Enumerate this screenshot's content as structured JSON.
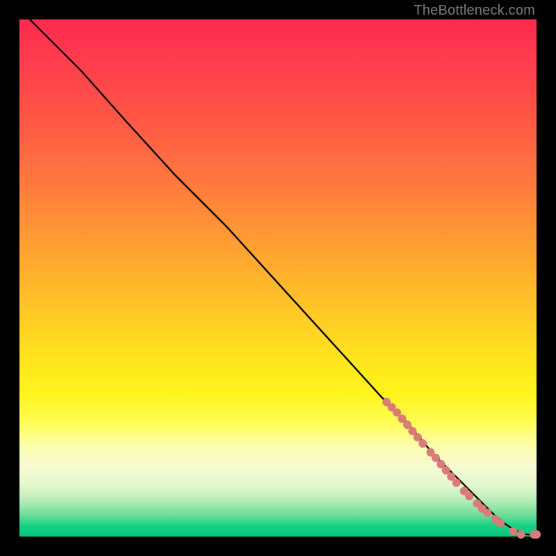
{
  "credit": "TheBottleneck.com",
  "chart_data": {
    "type": "line",
    "title": "",
    "xlabel": "",
    "ylabel": "",
    "xlim": [
      0,
      100
    ],
    "ylim": [
      0,
      100
    ],
    "series": [
      {
        "name": "curve",
        "x": [
          0,
          3,
          7,
          12,
          20,
          30,
          40,
          50,
          60,
          70,
          75,
          80,
          84,
          87,
          90,
          92,
          94,
          95.5,
          97,
          98,
          100
        ],
        "y": [
          102,
          99,
          95,
          90,
          81,
          70,
          60,
          49,
          38,
          27,
          22,
          16,
          12,
          9,
          6,
          4,
          2.4,
          1.4,
          0.7,
          0.4,
          0.4
        ]
      }
    ],
    "markers": [
      {
        "x": 71.0,
        "y": 26.0,
        "r": 6
      },
      {
        "x": 72.0,
        "y": 25.0,
        "r": 6
      },
      {
        "x": 73.0,
        "y": 24.0,
        "r": 6
      },
      {
        "x": 74.0,
        "y": 22.8,
        "r": 6
      },
      {
        "x": 75.0,
        "y": 21.6,
        "r": 6
      },
      {
        "x": 76.0,
        "y": 20.4,
        "r": 6
      },
      {
        "x": 77.0,
        "y": 19.2,
        "r": 6
      },
      {
        "x": 78.0,
        "y": 18.0,
        "r": 6
      },
      {
        "x": 79.5,
        "y": 16.3,
        "r": 6
      },
      {
        "x": 80.5,
        "y": 15.2,
        "r": 6
      },
      {
        "x": 81.5,
        "y": 14.0,
        "r": 6
      },
      {
        "x": 82.5,
        "y": 12.8,
        "r": 6
      },
      {
        "x": 83.5,
        "y": 11.6,
        "r": 6
      },
      {
        "x": 84.5,
        "y": 10.4,
        "r": 6
      },
      {
        "x": 86.0,
        "y": 8.8,
        "r": 6
      },
      {
        "x": 87.0,
        "y": 7.8,
        "r": 6
      },
      {
        "x": 88.5,
        "y": 6.4,
        "r": 6
      },
      {
        "x": 89.5,
        "y": 5.4,
        "r": 6
      },
      {
        "x": 90.5,
        "y": 4.6,
        "r": 6
      },
      {
        "x": 92.0,
        "y": 3.4,
        "r": 6
      },
      {
        "x": 93.0,
        "y": 2.6,
        "r": 6
      },
      {
        "x": 95.5,
        "y": 1.0,
        "r": 6
      },
      {
        "x": 97.0,
        "y": 0.4,
        "r": 6
      },
      {
        "x": 99.5,
        "y": 0.4,
        "r": 6
      },
      {
        "x": 100.0,
        "y": 0.4,
        "r": 6
      }
    ],
    "marker_color": "#da7b78",
    "line_color": "#000000"
  }
}
